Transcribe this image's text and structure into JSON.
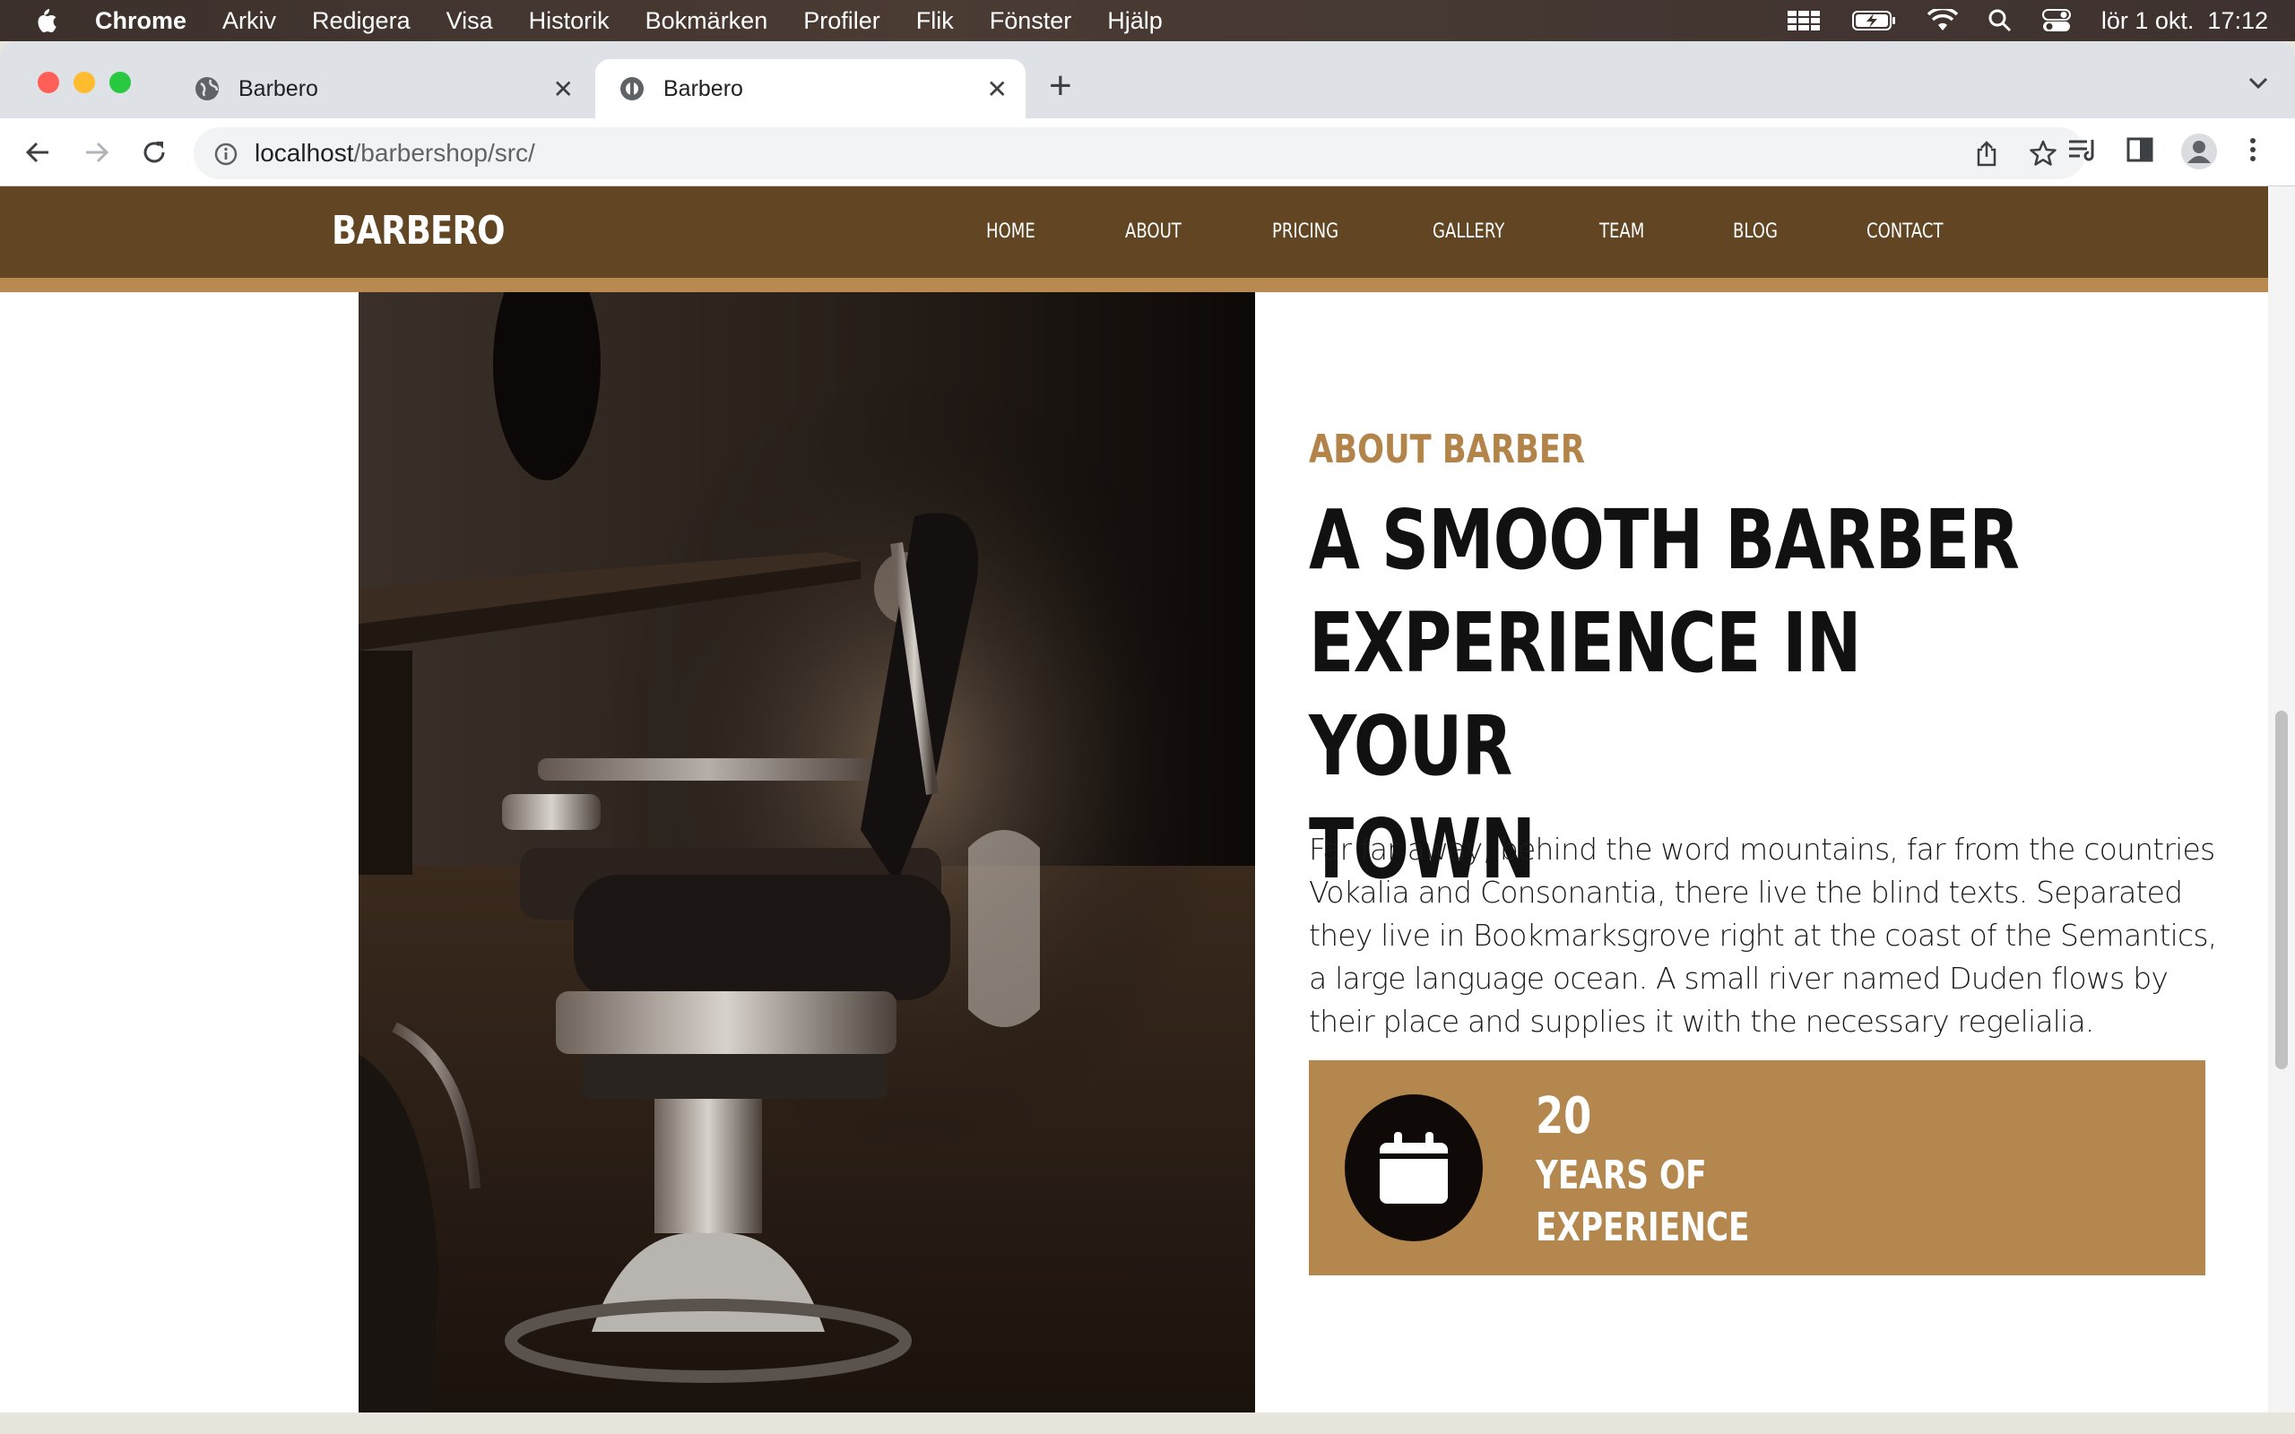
{
  "menubar": {
    "app_name": "Chrome",
    "menus": [
      "Arkiv",
      "Redigera",
      "Visa",
      "Historik",
      "Bokmärken",
      "Profiler",
      "Flik",
      "Fönster",
      "Hjälp"
    ],
    "datetime": "lör 1 okt.  17:12"
  },
  "browser": {
    "tabs": [
      {
        "title": "Barbero",
        "active": false
      },
      {
        "title": "Barbero",
        "active": true
      }
    ],
    "url_host": "localhost",
    "url_path": "/barbershop/src/"
  },
  "site": {
    "logo": "BARBERO",
    "nav": [
      "HOME",
      "ABOUT",
      "PRICING",
      "GALLERY",
      "TEAM",
      "BLOG",
      "CONTACT"
    ],
    "colors": {
      "nav_bg": "#624623",
      "accent": "#b98a4f",
      "stat_bg": "#b3874e"
    }
  },
  "about": {
    "kicker": "ABOUT BARBER",
    "headline_lines": [
      "A SMOOTH BARBER",
      "EXPERIENCE IN YOUR",
      "TOWN"
    ],
    "body_lines": [
      "Far far away, behind the word mountains, far from the countries",
      "Vokalia and Consonantia, there live the blind texts. Separated",
      "they live in Bookmarksgrove right at the coast of the Semantics,",
      "a large language ocean. A small river named Duden flows by",
      "their place and supplies it with the necessary regelialia."
    ],
    "stat": {
      "number": "20",
      "label_lines": [
        "YEARS OF",
        "EXPERIENCE"
      ],
      "icon": "calendar-icon"
    }
  }
}
